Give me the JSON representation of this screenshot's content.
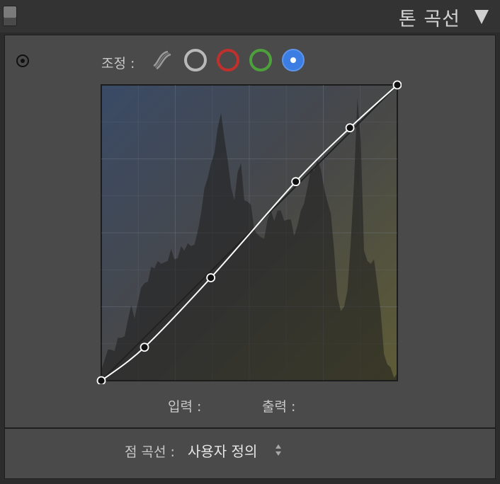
{
  "header": {
    "title": "톤 곡선"
  },
  "adjust": {
    "label": "조정 :",
    "channels": [
      "parametric-icon",
      "rgb-circle",
      "red-circle",
      "green-circle",
      "blue-circle"
    ],
    "active_channel": "blue",
    "colors": {
      "rgb": "#b9b9b9",
      "red": "#c0302c",
      "green": "#4ea03c",
      "blue": "#3b7de2"
    }
  },
  "curve": {
    "points": [
      [
        0,
        0
      ],
      [
        0.146,
        0.113
      ],
      [
        0.37,
        0.348
      ],
      [
        0.657,
        0.673
      ],
      [
        0.84,
        0.855
      ],
      [
        1,
        1
      ]
    ],
    "histogram": [
      0.02,
      0.08,
      0.1,
      0.09,
      0.11,
      0.14,
      0.13,
      0.16,
      0.2,
      0.24,
      0.22,
      0.26,
      0.3,
      0.34,
      0.33,
      0.37,
      0.39,
      0.4,
      0.38,
      0.41,
      0.4,
      0.43,
      0.42,
      0.41,
      0.44,
      0.45,
      0.46,
      0.44,
      0.47,
      0.5,
      0.55,
      0.66,
      0.68,
      0.72,
      0.78,
      0.85,
      0.89,
      0.83,
      0.74,
      0.64,
      0.62,
      0.7,
      0.72,
      0.62,
      0.6,
      0.58,
      0.52,
      0.49,
      0.47,
      0.49,
      0.54,
      0.56,
      0.55,
      0.57,
      0.56,
      0.55,
      0.54,
      0.53,
      0.5,
      0.52,
      0.56,
      0.61,
      0.65,
      0.7,
      0.72,
      0.74,
      0.7,
      0.66,
      0.6,
      0.55,
      0.45,
      0.28,
      0.22,
      0.26,
      0.3,
      0.45,
      0.68,
      0.95,
      0.8,
      0.45,
      0.4,
      0.38,
      0.42,
      0.32,
      0.22,
      0.1,
      0.05,
      0.03,
      0.02,
      0.02
    ],
    "grid": "quarters"
  },
  "io": {
    "input_label": "입력 :",
    "output_label": "출력 :"
  },
  "point_curve": {
    "label": "점 곡선 :",
    "value": "사용자 정의"
  }
}
